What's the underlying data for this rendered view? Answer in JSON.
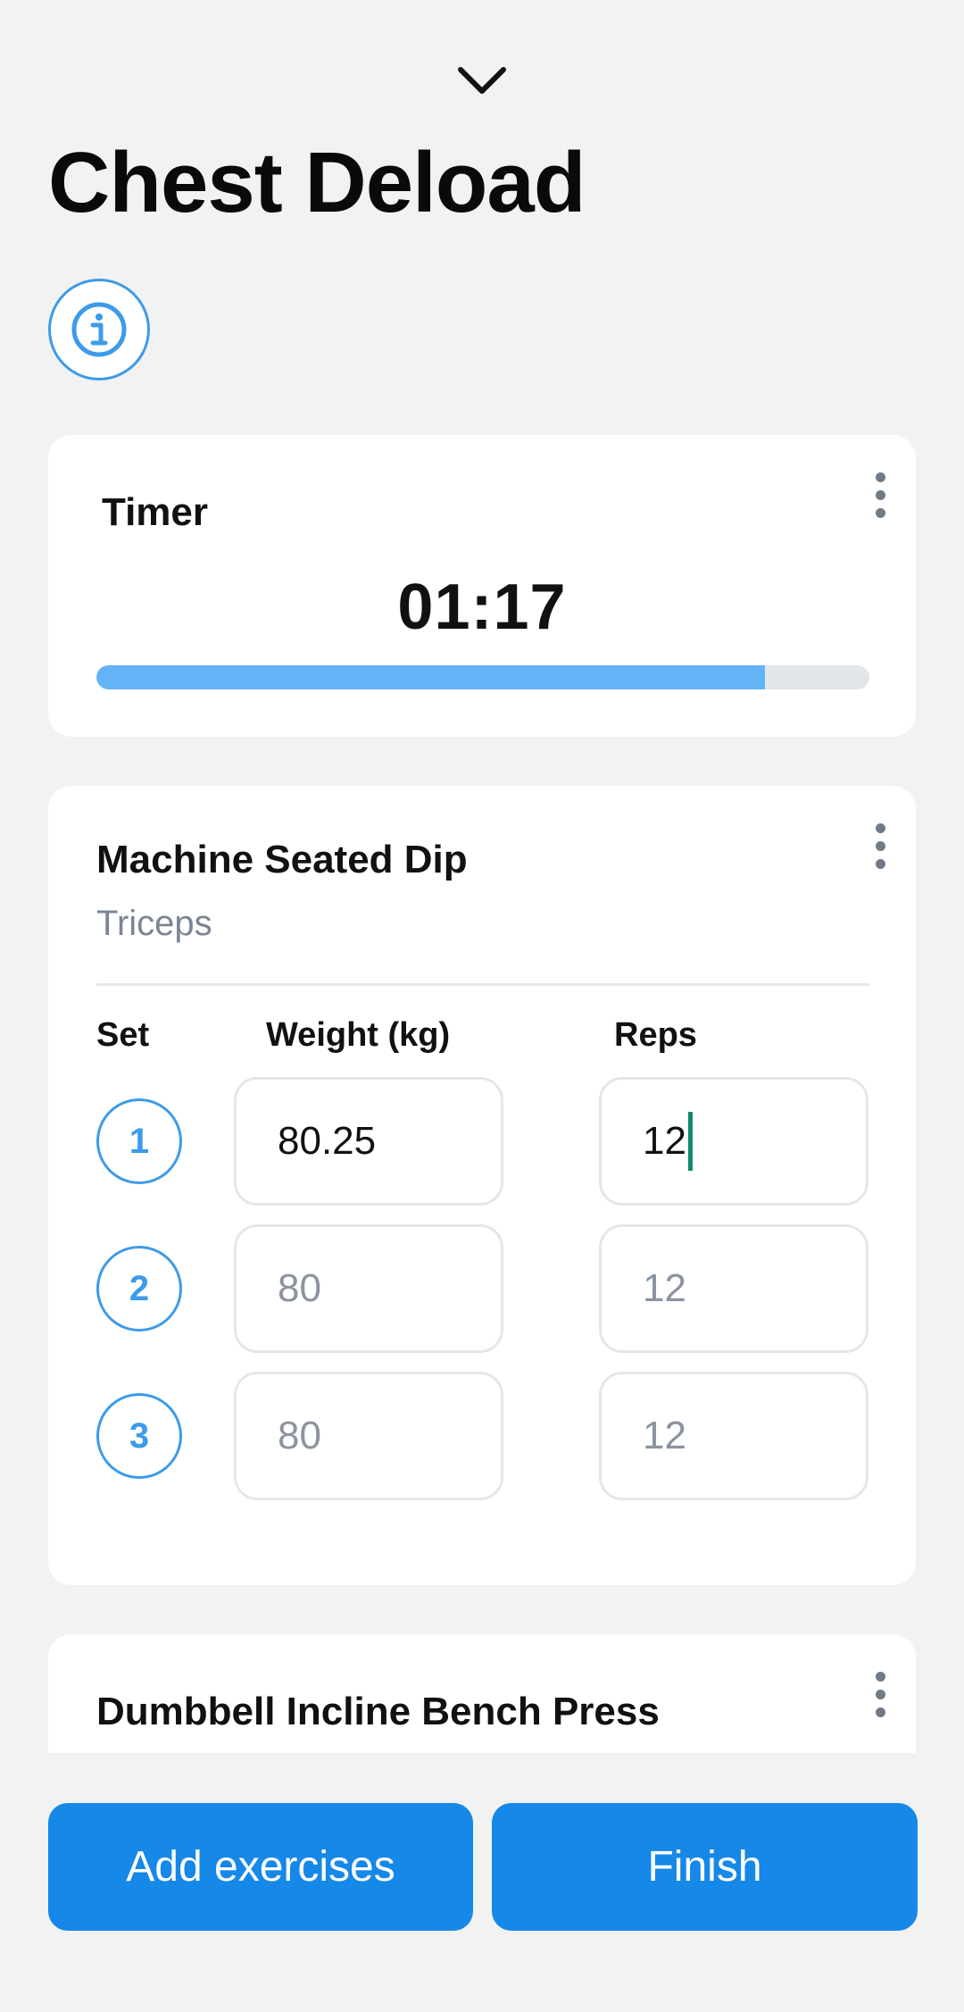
{
  "header": {
    "collapse_icon": "chevron-down-icon",
    "title": "Chest Deload",
    "info_icon": "info-icon"
  },
  "timer": {
    "label": "Timer",
    "value": "01:17",
    "progress_fraction": 0.865,
    "menu_icon": "more-vertical-icon"
  },
  "exercise": {
    "name": "Machine Seated Dip",
    "muscle": "Triceps",
    "menu_icon": "more-vertical-icon",
    "columns": {
      "set": "Set",
      "weight": "Weight (kg)",
      "reps": "Reps"
    },
    "sets": [
      {
        "number": "1",
        "weight_value": "80.25",
        "weight_placeholder": "",
        "reps_value": "12",
        "reps_placeholder": ""
      },
      {
        "number": "2",
        "weight_value": "",
        "weight_placeholder": "80",
        "reps_value": "",
        "reps_placeholder": "12"
      },
      {
        "number": "3",
        "weight_value": "",
        "weight_placeholder": "80",
        "reps_value": "",
        "reps_placeholder": "12"
      }
    ]
  },
  "next_exercise": {
    "name": "Dumbbell Incline Bench Press",
    "menu_icon": "more-vertical-icon"
  },
  "actions": {
    "add_exercises": "Add exercises",
    "finish": "Finish"
  },
  "colors": {
    "accent": "#1588e8",
    "set_circle": "#3d9be9",
    "progress": "#64b3f6",
    "caret": "#0f8a6e"
  }
}
